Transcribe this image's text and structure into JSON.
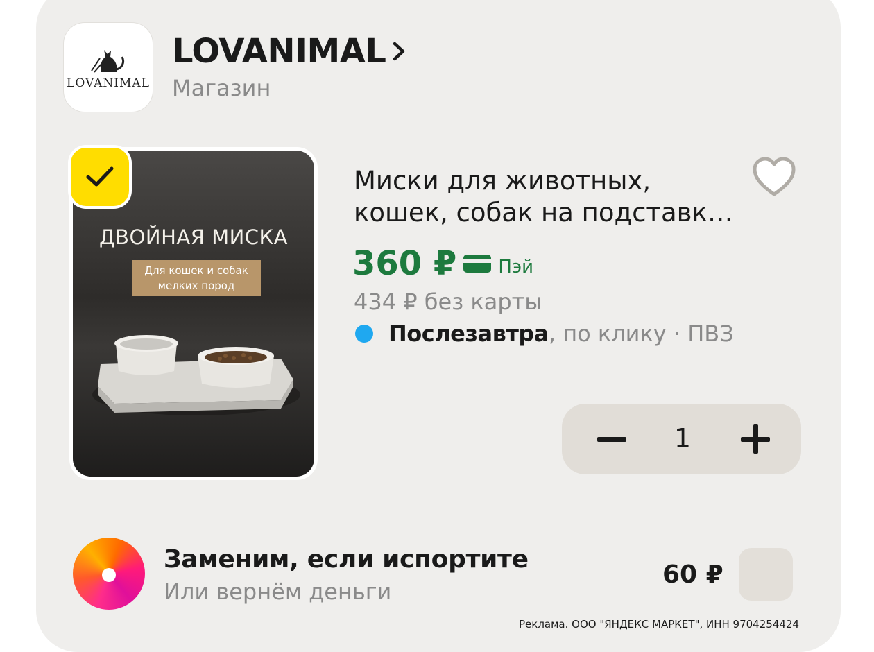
{
  "store": {
    "logo_text": "LOVANIMAL",
    "name": "LOVANIMAL",
    "chevron": "›",
    "subtitle": "Магазин"
  },
  "product": {
    "image": {
      "title": "ДВОЙНАЯ МИСКА",
      "subtitle_line1": "Для кошек и собак",
      "subtitle_line2": "мелких пород"
    },
    "selected": true,
    "name": "Миски для животных, кошек, собак на подставк…",
    "price": "360 ₽",
    "pay_label": "Пэй",
    "old_price": "434 ₽ без карты",
    "delivery_strong": "Послезавтра",
    "delivery_rest": ", по клику · ПВЗ",
    "quantity": "1",
    "colors": {
      "price_green": "#1d7a3e",
      "check_yellow": "#ffdd00",
      "delivery_dot": "#1fa8f0"
    }
  },
  "insurance": {
    "title": "Заменим, если испортите",
    "subtitle": "Или вернём деньги",
    "price": "60 ₽",
    "checked": false
  },
  "ad_text": "Реклама. ООО \"ЯНДЕКС МАРКЕТ\", ИНН 9704254424",
  "icons": [
    "cat-logo-icon",
    "chevron-right-icon",
    "checkmark-icon",
    "heart-icon",
    "card-icon",
    "minus-icon",
    "plus-icon",
    "plus-subscription-icon"
  ]
}
